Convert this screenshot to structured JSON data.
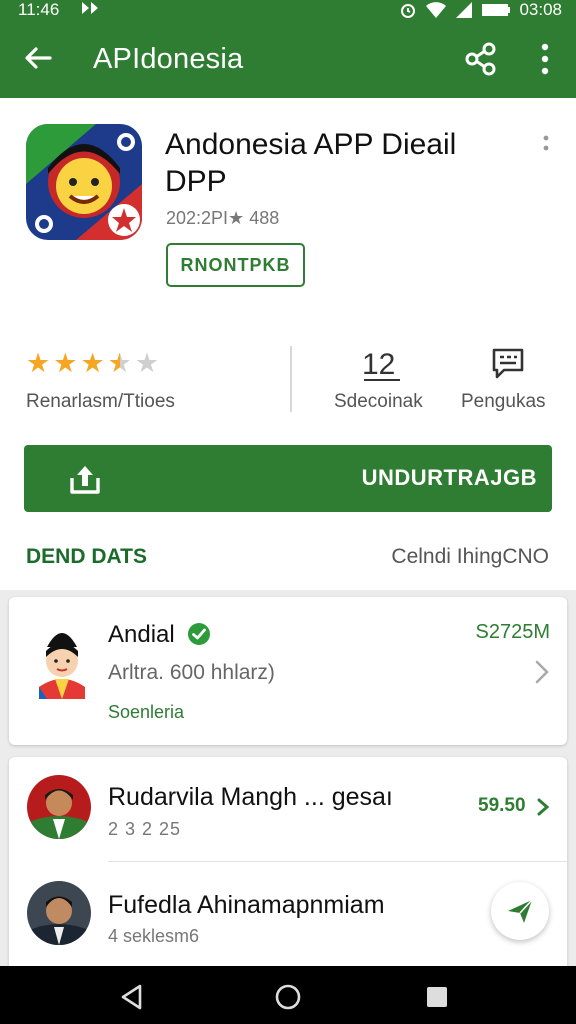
{
  "status_bar": {
    "time": "11:46",
    "clock_right": "03:08"
  },
  "app_bar": {
    "title": "APIdonesia",
    "back_icon": "arrow-left-icon",
    "share_icon": "share-icon",
    "more_icon": "more-vert-icon"
  },
  "app": {
    "title": "Andonesia APP Dieail DPP",
    "meta": "202:2PI★ 488",
    "tag": "RNONTPKB",
    "rating": {
      "value": 3.5,
      "max": 5,
      "label": "Renarlasm/Ttioes"
    },
    "stat1": {
      "label": "Sdecoinak",
      "icon": "download-count-icon",
      "value_text": "12"
    },
    "stat2": {
      "label": "Pengukas",
      "icon": "comment-icon"
    }
  },
  "install_button": {
    "label": "UNDURTRAJGB",
    "icon": "upload-icon"
  },
  "section": {
    "left": "DEND DATS",
    "right": "Celndi IhingCNO"
  },
  "card1": {
    "name": "Andial",
    "subtitle": "Arltra. 600 hhlarz)",
    "link": "Soenleria",
    "value": "S2725M"
  },
  "card2": {
    "items": [
      {
        "name": "Rudarvila Mangh ... gesaı",
        "sub": "2 3 2 25",
        "value": "59.50"
      },
      {
        "name": "Fufedla Ahinamapnmiam",
        "sub": "4 seklesm6"
      }
    ]
  },
  "colors": {
    "primary": "#2e7d32",
    "star": "#f5a623"
  },
  "nav": {
    "back": "nav-back-icon",
    "home": "nav-home-icon",
    "recents": "nav-recents-icon"
  }
}
